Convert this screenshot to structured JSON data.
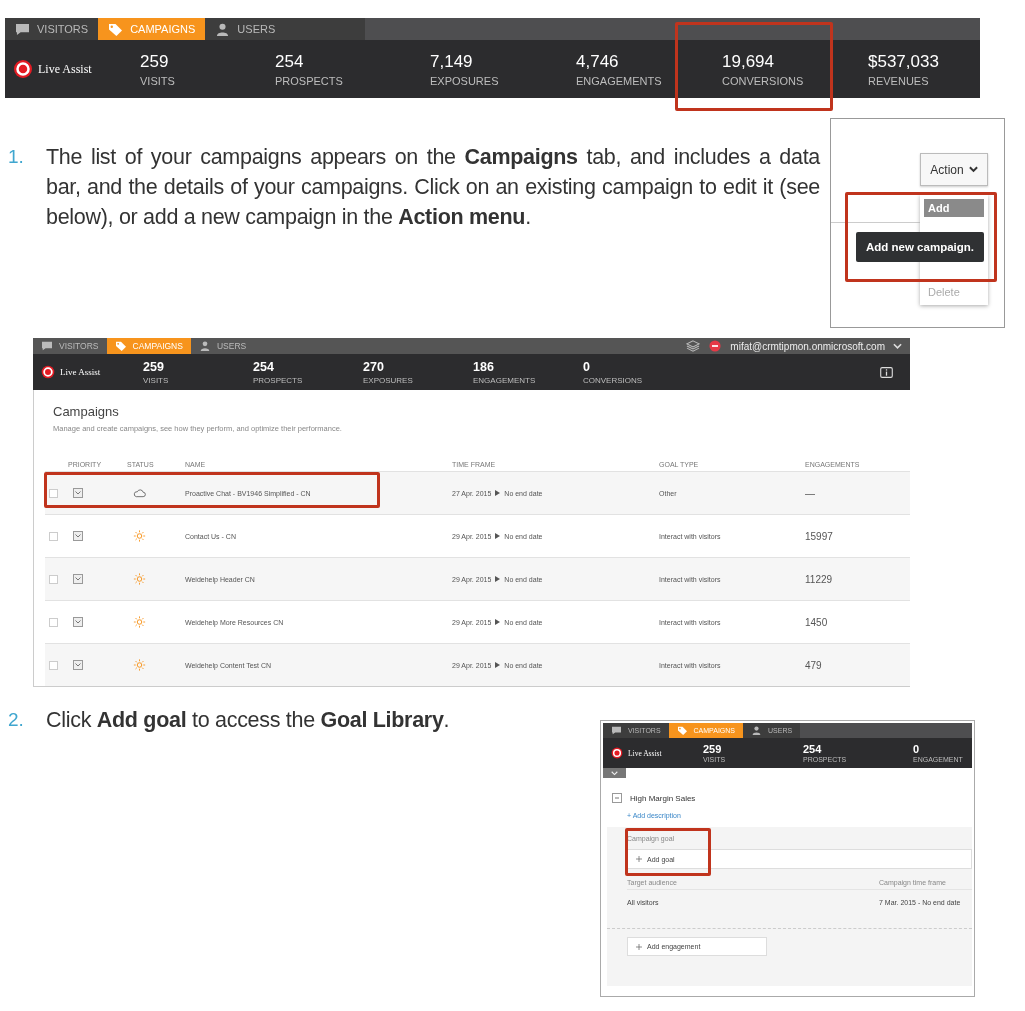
{
  "header_bar": {
    "tabs": [
      {
        "label": "VISITORS",
        "kind": "chat",
        "selected": false
      },
      {
        "label": "CAMPAIGNS",
        "kind": "tag",
        "selected": true
      },
      {
        "label": "USERS",
        "kind": "user",
        "selected": false
      }
    ],
    "logo": "Live Assist",
    "stats": [
      {
        "value": "259",
        "label": "VISITS",
        "highlighted": false
      },
      {
        "value": "254",
        "label": "PROSPECTS",
        "highlighted": false
      },
      {
        "value": "7,149",
        "label": "EXPOSURES",
        "highlighted": false
      },
      {
        "value": "4,746",
        "label": "ENGAGEMENTS",
        "highlighted": false
      },
      {
        "value": "19,694",
        "label": "CONVERSIONS",
        "highlighted": true
      },
      {
        "value": "$537,033",
        "label": "REVENUES",
        "highlighted": false
      }
    ]
  },
  "steps": [
    {
      "number": "1.",
      "text": "The list of your campaigns appears on the **Campaigns** tab, and includes a data bar, and the details of your campaigns. Click on an existing campaign to edit it (see below), or add a new campaign in the **Action menu**."
    },
    {
      "number": "2.",
      "text": "Click **Add goal** to access the **Goal Library**."
    }
  ],
  "action_menu": {
    "button": "Action",
    "items": [
      {
        "label": "Add",
        "selected": true,
        "disabled": false
      },
      {
        "label": "Delete",
        "selected": false,
        "disabled": true
      }
    ],
    "tooltip": "Add new campaign."
  },
  "campaigns_screen": {
    "tabs": [
      {
        "label": "VISITORS",
        "kind": "chat",
        "selected": false
      },
      {
        "label": "CAMPAIGNS",
        "kind": "tag",
        "selected": true
      },
      {
        "label": "USERS",
        "kind": "user",
        "selected": false
      }
    ],
    "user": "mifat@crmtipmon.onmicrosoft.com",
    "logo": "Live Assist",
    "stats": [
      {
        "value": "259",
        "label": "VISITS"
      },
      {
        "value": "254",
        "label": "PROSPECTS"
      },
      {
        "value": "270",
        "label": "EXPOSURES"
      },
      {
        "value": "186",
        "label": "ENGAGEMENTS"
      },
      {
        "value": "0",
        "label": "CONVERSIONS"
      }
    ],
    "title": "Campaigns",
    "subtitle": "Manage and create campaigns, see how they perform, and optimize their performance.",
    "columns": [
      "PRIORITY",
      "STATUS",
      "NAME",
      "TIME FRAME",
      "GOAL TYPE",
      "ENGAGEMENTS"
    ],
    "rows": [
      {
        "kind": "cloud",
        "name": "Proactive Chat - BV1946 Simplified - CN",
        "start": "27 Apr. 2015",
        "end": "No end date",
        "goal_type": "Other",
        "engagements": "—",
        "highlighted": true,
        "checked": false
      },
      {
        "kind": "sun",
        "name": "Contact Us - CN",
        "start": "29 Apr. 2015",
        "end": "No end date",
        "goal_type": "Interact with visitors",
        "engagements": "15997",
        "highlighted": false,
        "checked": false
      },
      {
        "kind": "sun",
        "name": "Weidehelp Header CN",
        "start": "29 Apr. 2015",
        "end": "No end date",
        "goal_type": "Interact with visitors",
        "engagements": "11229",
        "highlighted": false,
        "checked": false
      },
      {
        "kind": "sun",
        "name": "Weidehelp More Resources CN",
        "start": "29 Apr. 2015",
        "end": "No end date",
        "goal_type": "Interact with visitors",
        "engagements": "1450",
        "highlighted": false,
        "checked": false
      },
      {
        "kind": "sun",
        "name": "Weidehelp Content Test CN",
        "start": "29 Apr. 2015",
        "end": "No end date",
        "goal_type": "Interact with visitors",
        "engagements": "479",
        "highlighted": false,
        "checked": false
      }
    ]
  },
  "campaign_editor": {
    "tabs": [
      {
        "label": "VISITORS",
        "kind": "chat",
        "selected": false
      },
      {
        "label": "CAMPAIGNS",
        "kind": "tag",
        "selected": true
      },
      {
        "label": "USERS",
        "kind": "user",
        "selected": false
      }
    ],
    "logo": "Live Assist",
    "stats": [
      {
        "value": "259",
        "label": "VISITS"
      },
      {
        "value": "254",
        "label": "PROSPECTS"
      },
      {
        "value": "0",
        "label": "ENGAGEMENT"
      }
    ],
    "toggle_expanded": false,
    "campaign_name": "High Margin Sales",
    "add_description": "+ Add description",
    "goal_label": "Campaign goal",
    "add_goal": "Add goal",
    "goal_highlighted": true,
    "audience_label": "Target audience",
    "audience": "All visitors",
    "timeframe_label": "Campaign time frame",
    "timeframe": "7 Mar. 2015 - No end date",
    "add_engagement": "Add engagement"
  }
}
